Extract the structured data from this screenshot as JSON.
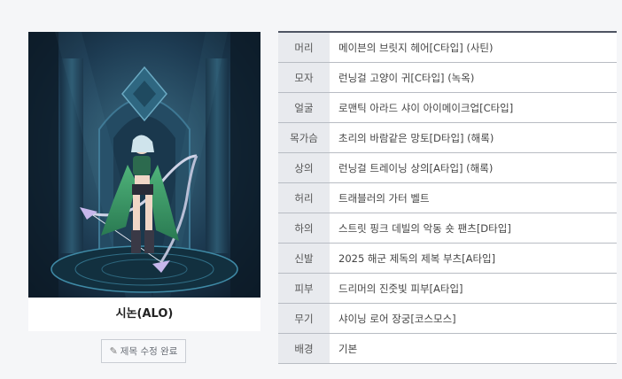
{
  "character": {
    "name": "시논(ALO)",
    "image_icon": "character-illustration"
  },
  "title_button": {
    "label": "제목 수정 완료",
    "icon": "pencil-icon"
  },
  "equipment": [
    {
      "slot": "머리",
      "item": "메이븐의 브릿지 헤어[C타입] (사틴)"
    },
    {
      "slot": "모자",
      "item": "런닝걸 고양이 귀[C타입] (녹옥)"
    },
    {
      "slot": "얼굴",
      "item": "로맨틱 아라드 샤이 아이메이크업[C타입]"
    },
    {
      "slot": "목가슴",
      "item": "초리의 바람같은 망토[D타입] (해록)"
    },
    {
      "slot": "상의",
      "item": "런닝걸 트레이닝 상의[A타입] (해록)"
    },
    {
      "slot": "허리",
      "item": "트래블러의 가터 벨트"
    },
    {
      "slot": "하의",
      "item": "스트릿 핑크 데빌의 악동 숏 팬츠[D타입]"
    },
    {
      "slot": "신발",
      "item": "2025 해군 제독의 제복 부츠[A타입]"
    },
    {
      "slot": "피부",
      "item": "드리머의 진줏빛 피부[A타입]"
    },
    {
      "slot": "무기",
      "item": "샤이닝 로어 장궁[코스모스]"
    },
    {
      "slot": "배경",
      "item": "기본"
    }
  ],
  "colors": {
    "page_bg": "#f5f6f8",
    "slot_bg": "#e8eaee",
    "table_top_border": "#4e5462"
  }
}
